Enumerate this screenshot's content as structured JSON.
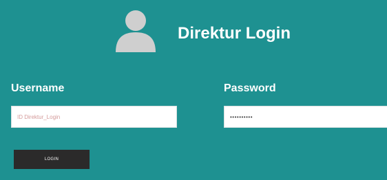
{
  "header": {
    "icon": "user-avatar-icon",
    "title": "Direktur Login"
  },
  "form": {
    "username": {
      "label": "Username",
      "placeholder": "ID Direktur_Login",
      "value": ""
    },
    "password": {
      "label": "Password",
      "placeholder": "",
      "value": "••••••••••"
    },
    "login_label": "LOGIN"
  },
  "colors": {
    "background": "#1e9191",
    "button": "#2b2a2a",
    "avatar": "#cfcfcf"
  }
}
